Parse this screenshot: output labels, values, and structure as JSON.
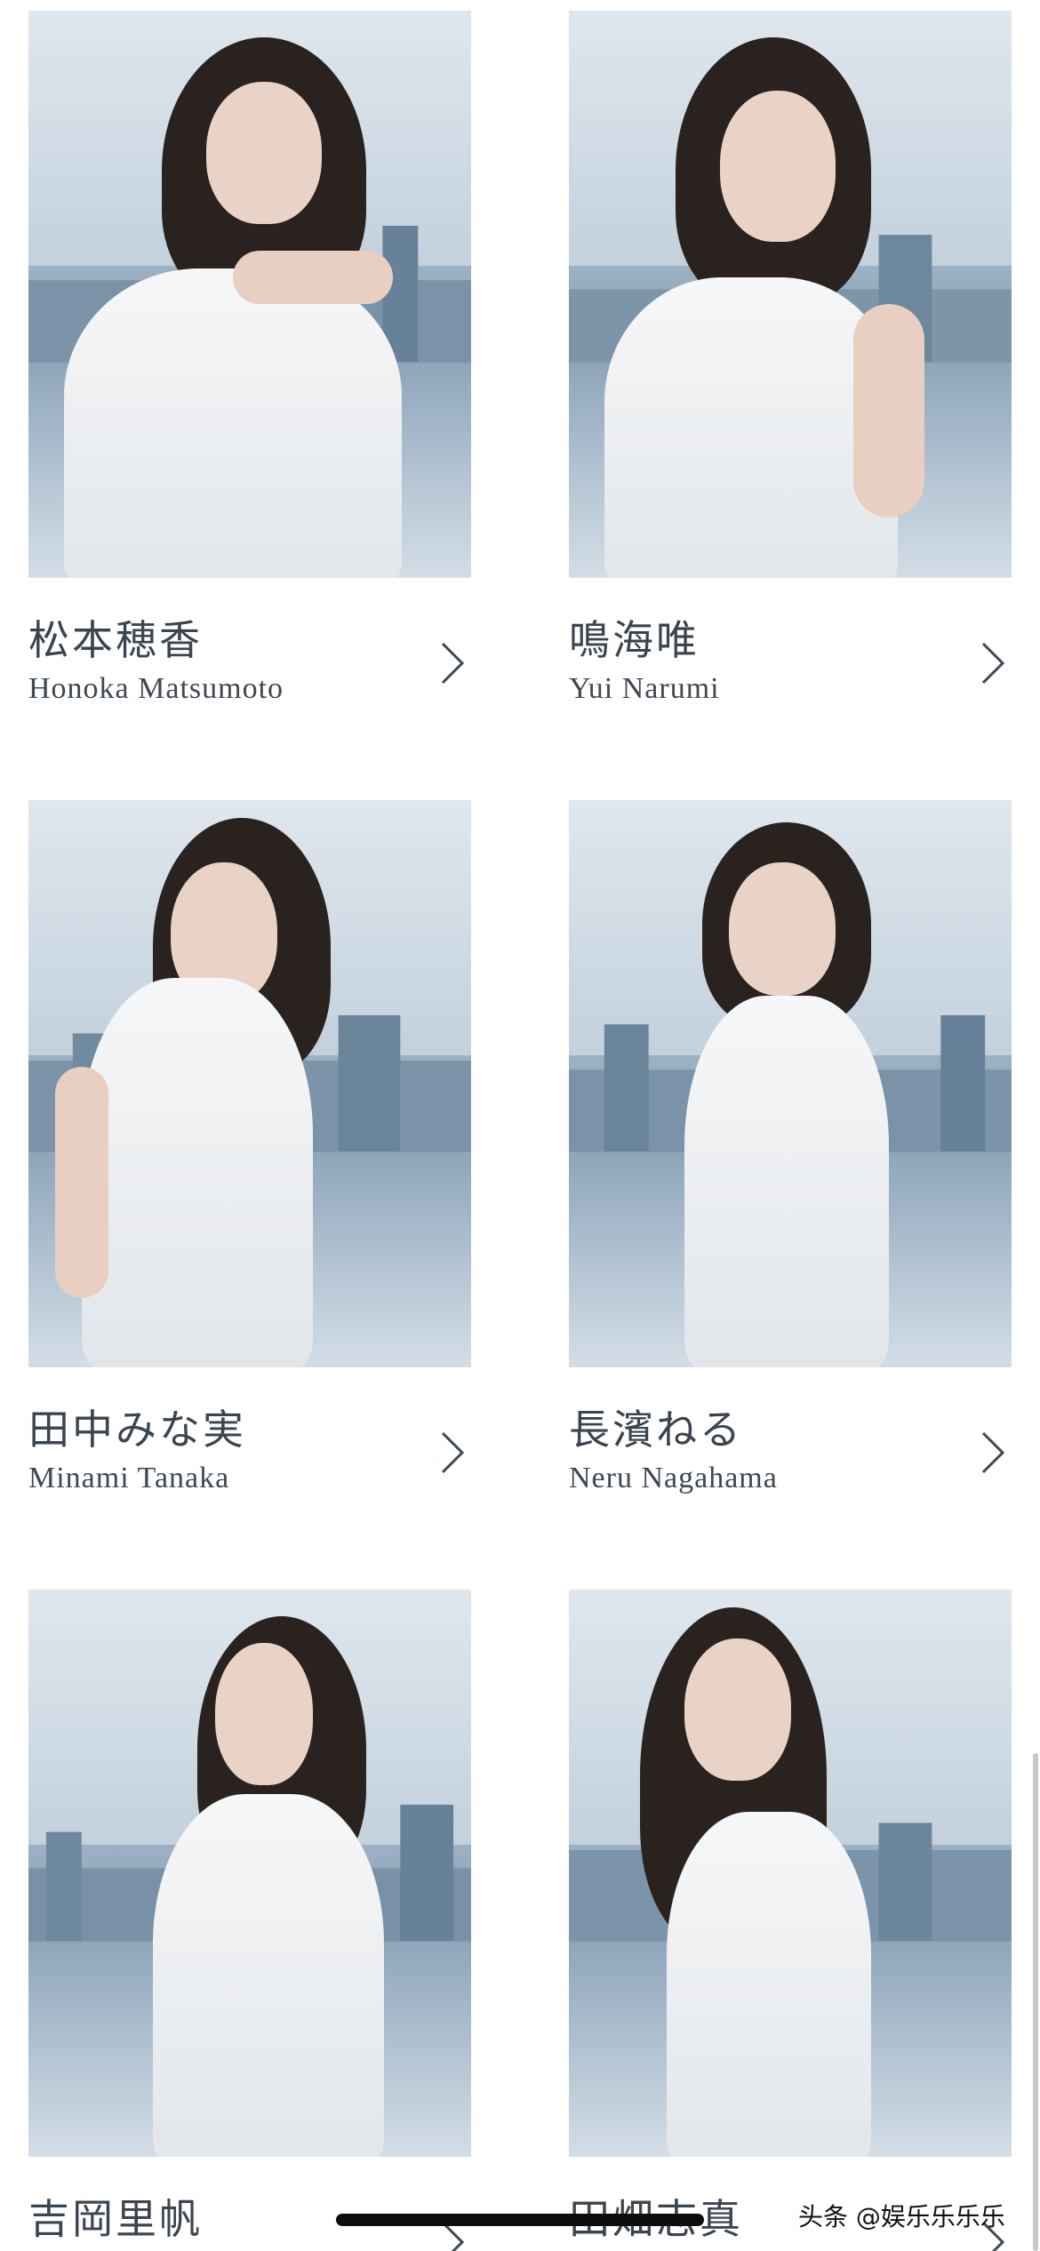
{
  "profiles": [
    {
      "name_jp": "松本穂香",
      "name_en": "Honoka Matsumoto"
    },
    {
      "name_jp": "鳴海唯",
      "name_en": "Yui Narumi"
    },
    {
      "name_jp": "田中みな実",
      "name_en": "Minami Tanaka"
    },
    {
      "name_jp": "長濱ねる",
      "name_en": "Neru Nagahama"
    },
    {
      "name_jp": "吉岡里帆",
      "name_en": ""
    },
    {
      "name_jp": "田畑志真",
      "name_en": ""
    }
  ],
  "watermark": "头条 @娱乐乐乐乐",
  "icons": {
    "row_action": "chevron-right-icon"
  },
  "colors": {
    "text": "#3a4550",
    "photo_tint": "#8ea5ba"
  }
}
